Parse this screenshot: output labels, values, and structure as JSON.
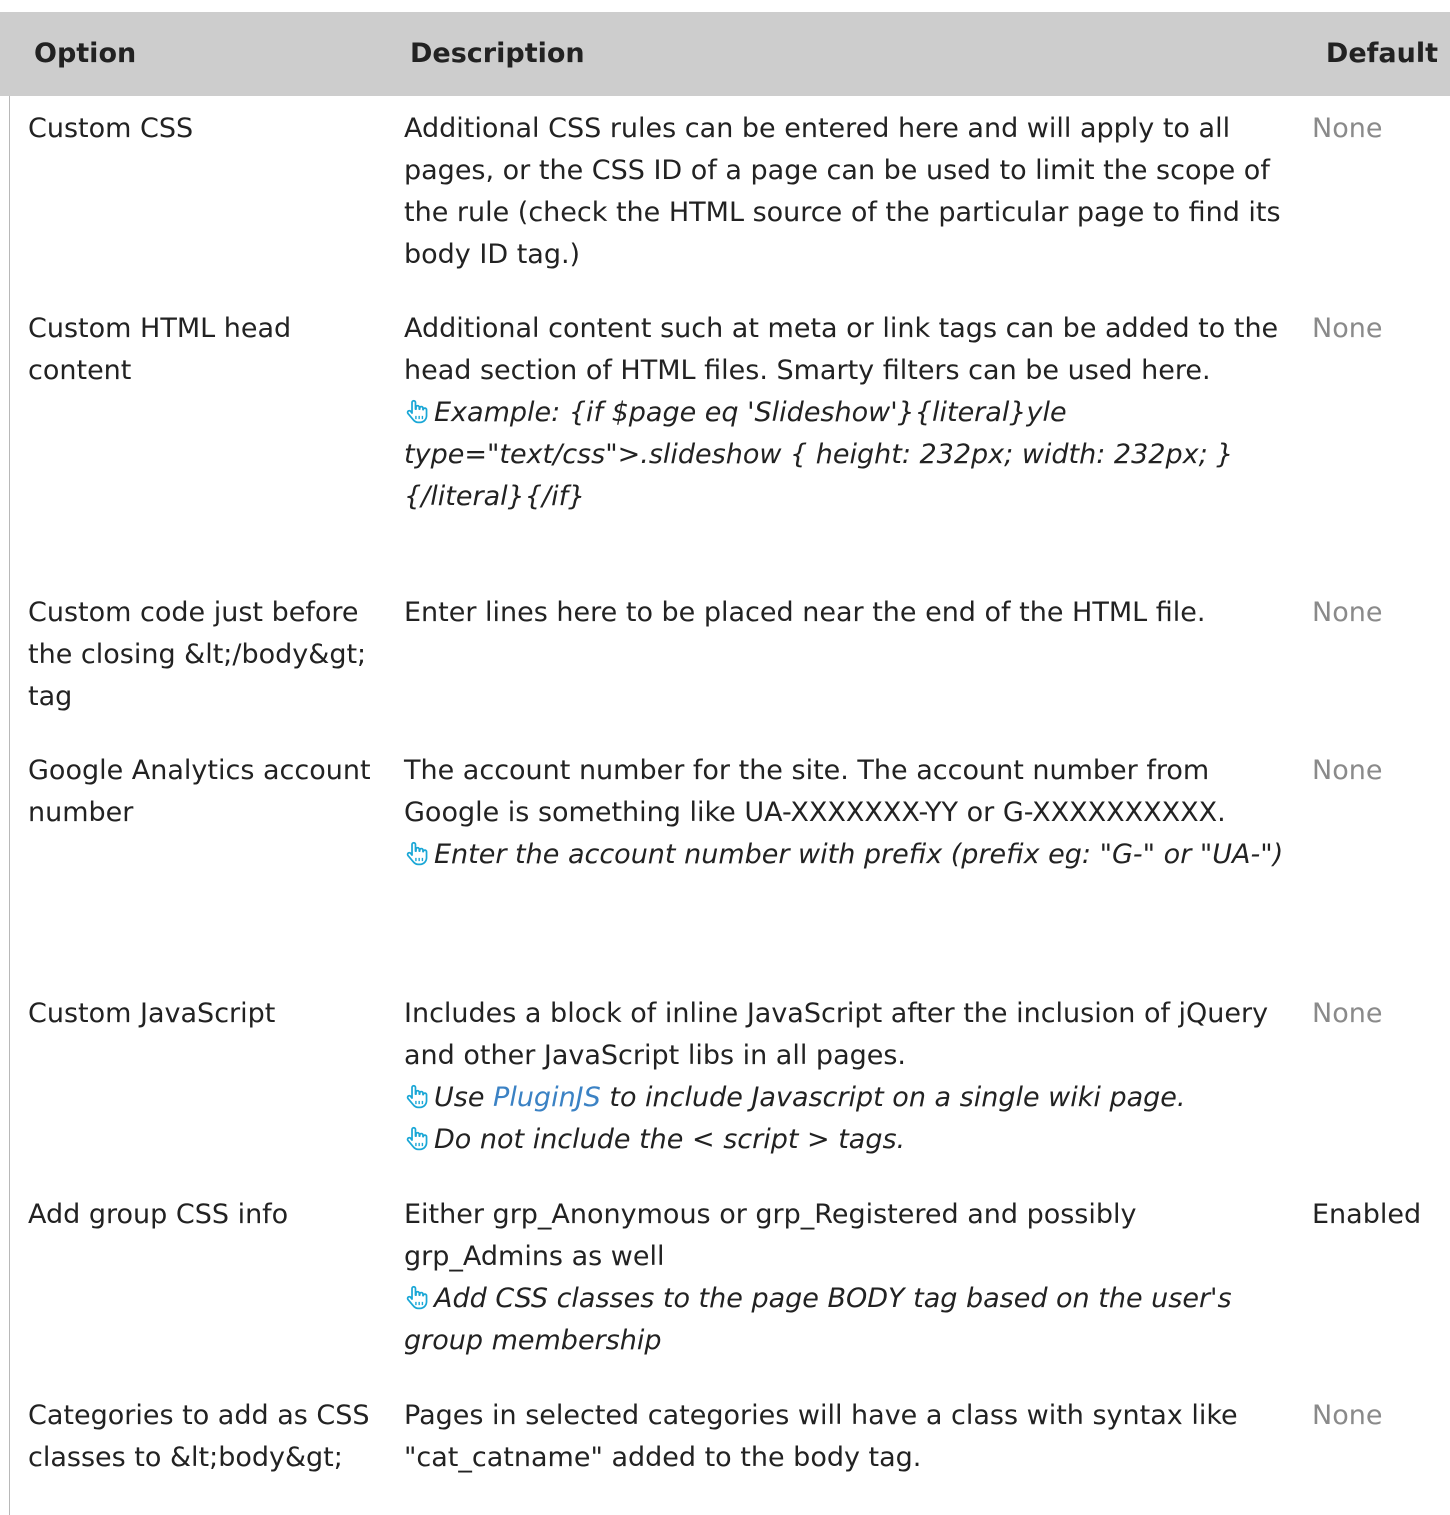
{
  "table": {
    "headers": {
      "option": "Option",
      "description": "Description",
      "default": "Default"
    },
    "rows": [
      {
        "option": "Custom CSS",
        "description": "Additional CSS rules can be entered here and will apply to all pages, or the CSS ID of a page can be used to limit the scope of the rule (check the HTML source of the particular page to find its body ID tag.)",
        "default": "None"
      },
      {
        "option": "Custom HTML head content",
        "description": "Additional content such at meta or link tags can be added to the head section of HTML files. Smarty filters can be used here.",
        "tip": "Example: {if $page eq 'Slideshow'}{literal}yle type=\"text/css\">.slideshow { height: 232px; width: 232px; }{/literal}{/if}",
        "default": "None"
      },
      {
        "option": "Custom code just before the closing &lt;/body&gt; tag",
        "description": "Enter lines here to be placed near the end of the HTML file.",
        "default": "None"
      },
      {
        "option": "Google Analytics account number",
        "description": "The account number for the site. The account number from Google is something like UA-XXXXXXX-YY or G-XXXXXXXXXX.",
        "tip": "Enter the account number with prefix (prefix eg: \"G-\" or \"UA-\")",
        "default": "None"
      },
      {
        "option": "Custom JavaScript",
        "description": "Includes a block of inline JavaScript after the inclusion of jQuery and other JavaScript libs in all pages.",
        "tip_pre": "Use ",
        "tip_link": "PluginJS",
        "tip_post": " to include Javascript on a single wiki page.",
        "tip2": "Do not include the < script > tags.",
        "default": "None"
      },
      {
        "option": "Add group CSS info",
        "description": "Either grp_Anonymous or grp_Registered and possibly grp_Admins as well",
        "tip": "Add CSS classes to the page BODY tag based on the user's group membership",
        "default": "Enabled"
      },
      {
        "option": "Categories to add as CSS classes to &lt;body&gt;",
        "description": "Pages in selected categories will have a class with syntax like \"cat_catname\" added to the body tag.",
        "default": "None"
      }
    ]
  },
  "icons": {
    "tip": "pointing-hand-icon"
  },
  "colors": {
    "header_bg": "#cdcdcd",
    "muted_default": "#8a8a8a",
    "link": "#3b82c4",
    "icon": "#1aa7d6"
  }
}
